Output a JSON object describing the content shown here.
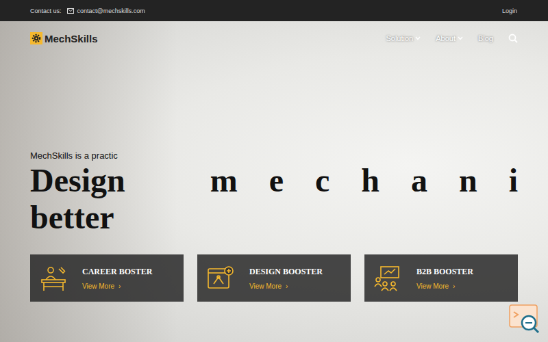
{
  "top_bar": {
    "contact_label": "Contact us:",
    "email": "contact@mechskills.com",
    "login": "Login"
  },
  "header": {
    "logo": "MechSkills",
    "nav": [
      {
        "label": "Solution",
        "has_dropdown": true
      },
      {
        "label": "About",
        "has_dropdown": true
      },
      {
        "label": "Blog",
        "has_dropdown": false
      }
    ]
  },
  "hero": {
    "subtitle": "MechSkills is a practic",
    "title": "Design better",
    "letters": [
      "m",
      "e",
      "c",
      "h",
      "a",
      "n",
      "i"
    ]
  },
  "cards": [
    {
      "title": "CAREER BOSTER",
      "link": "View More",
      "arrow": "›"
    },
    {
      "title": "DESIGN BOOSTER",
      "link": "View More",
      "arrow": "›"
    },
    {
      "title": "B2B BOOSTER",
      "link": "View More",
      "arrow": "›"
    }
  ]
}
